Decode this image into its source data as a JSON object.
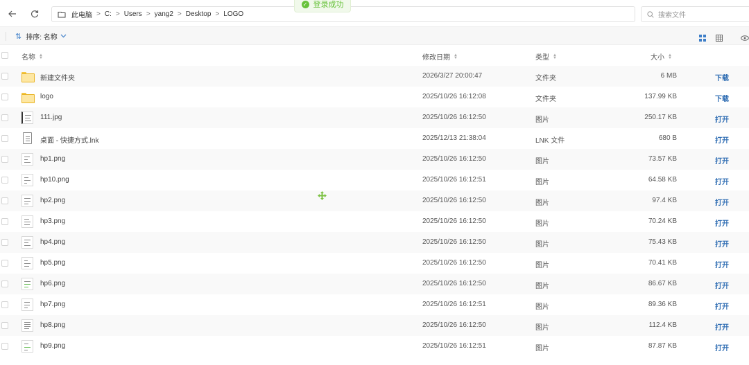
{
  "address": {
    "root": "此电脑",
    "segments": [
      "C:",
      "Users",
      "yang2",
      "Desktop",
      "LOGO"
    ]
  },
  "search": {
    "placeholder": "搜索文件"
  },
  "toast": {
    "message": "登录成功"
  },
  "toolbar": {
    "sort_label": "排序: 名称"
  },
  "columns": {
    "name": "名称",
    "mtime": "修改日期",
    "type": "类型",
    "size": "大小"
  },
  "files": [
    {
      "name": "新建文件夹",
      "mtime": "2026/3/27 20:00:47",
      "type": "文件夹",
      "size": "6 MB",
      "action": "下载",
      "icon": "folder-icon"
    },
    {
      "name": "logo",
      "mtime": "2025/10/26 16:12:08",
      "type": "文件夹",
      "size": "137.99 KB",
      "action": "下载",
      "icon": "folder-icon"
    },
    {
      "name": "111.jpg",
      "mtime": "2025/10/26 16:12:50",
      "type": "图片",
      "size": "250.17 KB",
      "action": "打开",
      "icon": "image-thumbnail-icon"
    },
    {
      "name": "桌面 - 快捷方式.lnk",
      "mtime": "2025/12/13 21:38:04",
      "type": "LNK 文件",
      "size": "680 B",
      "action": "打开",
      "icon": "shortcut-file-icon"
    },
    {
      "name": "hp1.png",
      "mtime": "2025/10/26 16:12:50",
      "type": "图片",
      "size": "73.57 KB",
      "action": "打开",
      "icon": "image-thumbnail-icon"
    },
    {
      "name": "hp10.png",
      "mtime": "2025/10/26 16:12:51",
      "type": "图片",
      "size": "64.58 KB",
      "action": "打开",
      "icon": "image-thumbnail-icon"
    },
    {
      "name": "hp2.png",
      "mtime": "2025/10/26 16:12:50",
      "type": "图片",
      "size": "97.4 KB",
      "action": "打开",
      "icon": "image-thumbnail-icon"
    },
    {
      "name": "hp3.png",
      "mtime": "2025/10/26 16:12:50",
      "type": "图片",
      "size": "70.24 KB",
      "action": "打开",
      "icon": "image-thumbnail-icon"
    },
    {
      "name": "hp4.png",
      "mtime": "2025/10/26 16:12:50",
      "type": "图片",
      "size": "75.43 KB",
      "action": "打开",
      "icon": "image-thumbnail-icon"
    },
    {
      "name": "hp5.png",
      "mtime": "2025/10/26 16:12:50",
      "type": "图片",
      "size": "70.41 KB",
      "action": "打开",
      "icon": "image-thumbnail-icon"
    },
    {
      "name": "hp6.png",
      "mtime": "2025/10/26 16:12:50",
      "type": "图片",
      "size": "86.67 KB",
      "action": "打开",
      "icon": "image-thumbnail-icon"
    },
    {
      "name": "hp7.png",
      "mtime": "2025/10/26 16:12:51",
      "type": "图片",
      "size": "89.36 KB",
      "action": "打开",
      "icon": "image-thumbnail-icon"
    },
    {
      "name": "hp8.png",
      "mtime": "2025/10/26 16:12:50",
      "type": "图片",
      "size": "112.4 KB",
      "action": "打开",
      "icon": "image-thumbnail-icon"
    },
    {
      "name": "hp9.png",
      "mtime": "2025/10/26 16:12:51",
      "type": "图片",
      "size": "87.87 KB",
      "action": "打开",
      "icon": "image-thumbnail-icon"
    }
  ],
  "colors": {
    "accent": "#2f6db3",
    "folder": "#f4c542",
    "toast_green": "#67c23a"
  }
}
